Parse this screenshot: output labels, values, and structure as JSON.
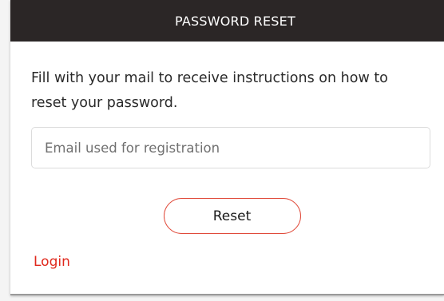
{
  "header": {
    "title": "PASSWORD RESET"
  },
  "form": {
    "instructions": "Fill with your mail to receive instructions on how to reset your password.",
    "email_placeholder": "Email used for registration",
    "email_value": "",
    "reset_label": "Reset",
    "login_label": "Login"
  },
  "colors": {
    "header_bg": "#2b2626",
    "accent": "#e0281c",
    "button_border": "#e04a3a"
  }
}
